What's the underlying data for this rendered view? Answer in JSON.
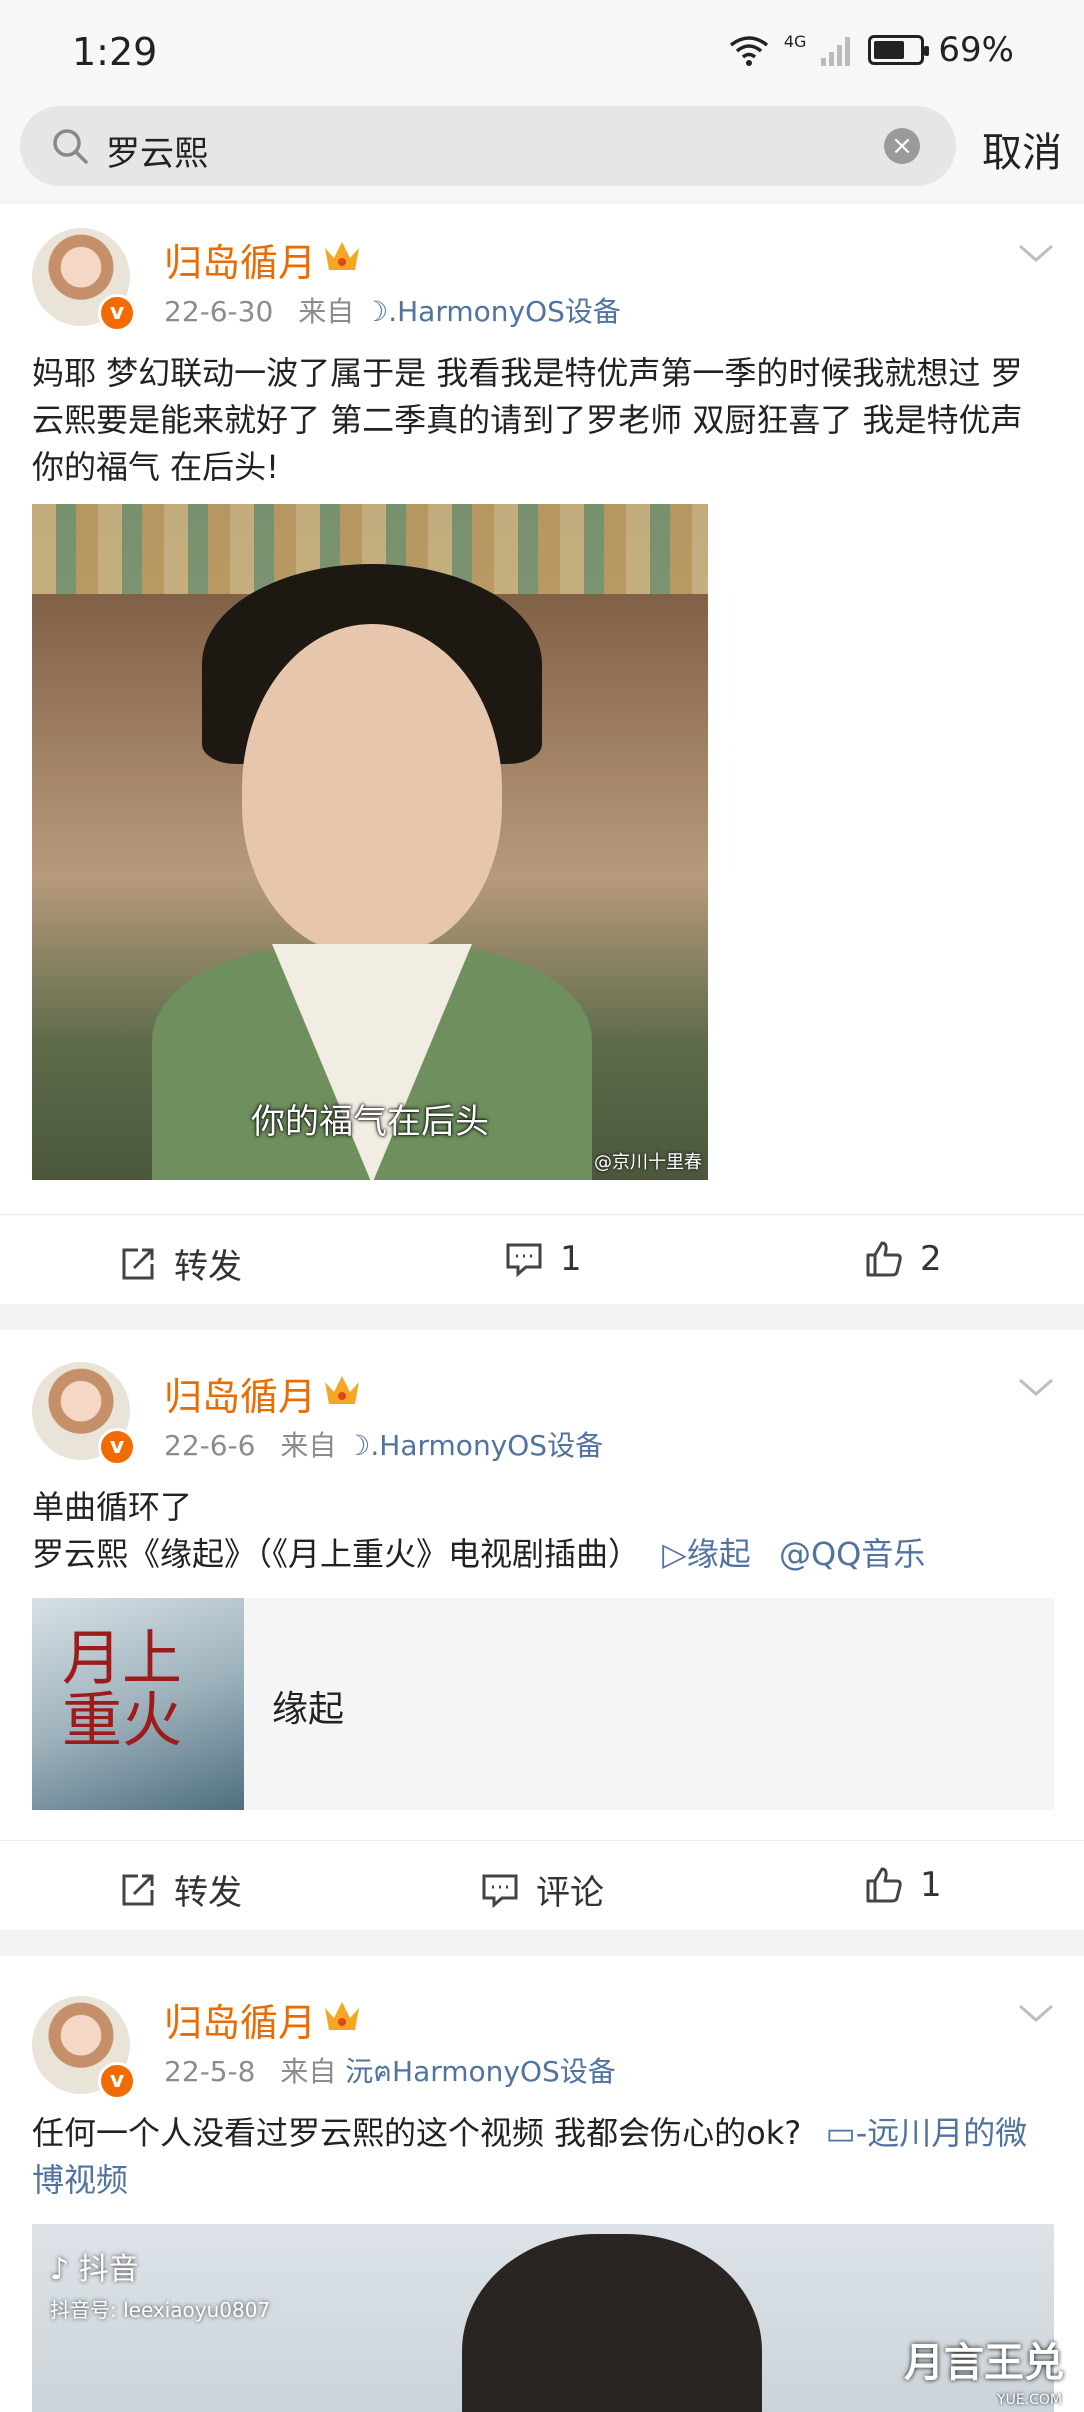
{
  "status_bar": {
    "time": "1:29",
    "network": "4G",
    "battery": "69%",
    "battery_level": 0.69
  },
  "search": {
    "query": "罗云熙",
    "cancel_label": "取消"
  },
  "posts": [
    {
      "username": "归岛循月",
      "date": "22-6-30",
      "source_prefix": "来自",
      "source": "☽.HarmonyOS设备",
      "text": "妈耶 梦幻联动一波了属于是 我看我是特优声第一季的时候我就想过 罗云熙要是能来就好了 第二季真的请到了罗老师 双厨狂喜了  我是特优声 你的福气 在后头!",
      "image_caption": "你的福气在后头",
      "image_watermark": "@京川十里春",
      "repost_label": "转发",
      "comment_label": "1",
      "like_count": "2"
    },
    {
      "username": "归岛循月",
      "date": "22-6-6",
      "source_prefix": "来自",
      "source": "☽.HarmonyOS设备",
      "text_line1": "单曲循环了",
      "text_line2": "罗云熙《缘起》（《月上重火》电视剧插曲）",
      "song_link": "▷缘起",
      "mention_link": "@QQ音乐",
      "music_title": "缘起",
      "cover_text": "月上重火",
      "repost_label": "转发",
      "comment_label": "评论",
      "like_count": "1"
    },
    {
      "username": "归岛循月",
      "date": "22-5-8",
      "source_prefix": "来自",
      "source": "沅ฅHarmonyOS设备",
      "text": "任何一个人没看过罗云熙的这个视频 我都会伤心的ok?",
      "video_link": "▭-远川月的微博视频",
      "video_app": "抖音",
      "video_id": "抖音号: leexiaoyu0807"
    }
  ],
  "corner_watermark": "月言王兑",
  "corner_watermark_sub": "YUE.COM",
  "colors": {
    "username": "#ea6c00",
    "link": "#50739f",
    "background": "#f2f2f2"
  }
}
